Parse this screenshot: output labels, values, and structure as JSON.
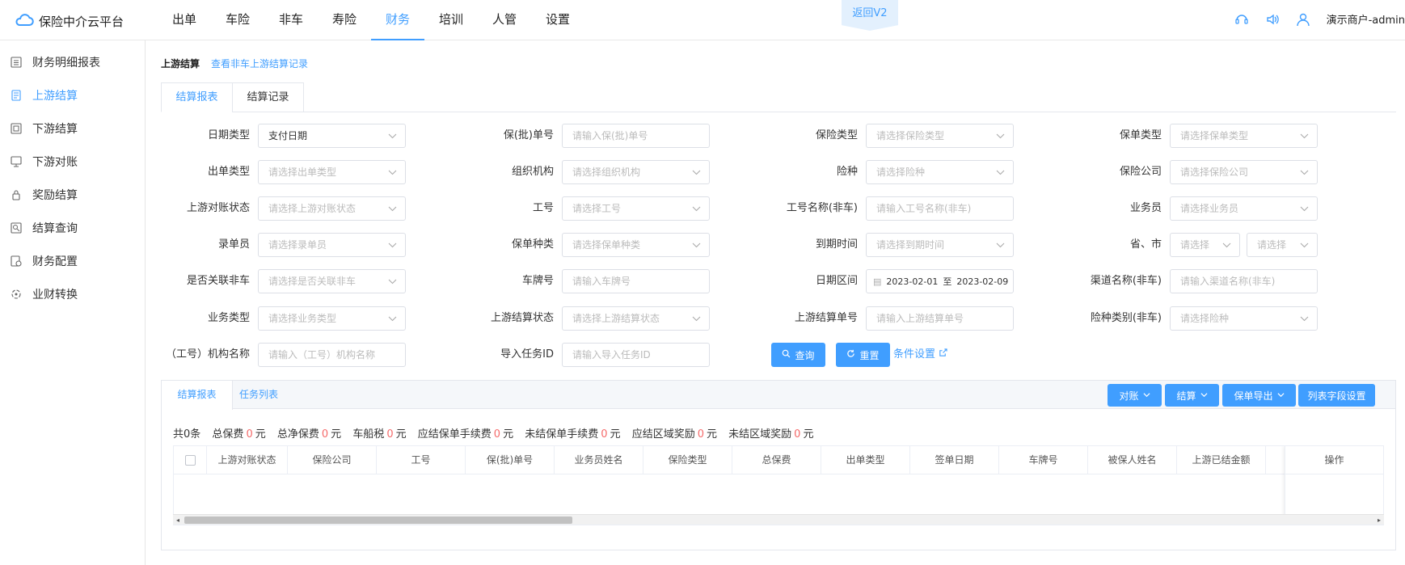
{
  "app": {
    "title": "保险中介云平台"
  },
  "topnav": [
    {
      "label": "出单",
      "active": false
    },
    {
      "label": "车险",
      "active": false
    },
    {
      "label": "非车",
      "active": false
    },
    {
      "label": "寿险",
      "active": false
    },
    {
      "label": "财务",
      "active": true
    },
    {
      "label": "培训",
      "active": false
    },
    {
      "label": "人管",
      "active": false
    },
    {
      "label": "设置",
      "active": false
    }
  ],
  "back_v2": "返回V2",
  "user": {
    "name": "演示商户-admin"
  },
  "sidebar": [
    {
      "label": "财务明细报表",
      "icon": "report-icon",
      "active": false
    },
    {
      "label": "上游结算",
      "icon": "upstream-settle-icon",
      "active": true
    },
    {
      "label": "下游结算",
      "icon": "downstream-settle-icon",
      "active": false
    },
    {
      "label": "下游对账",
      "icon": "reconcile-icon",
      "active": false
    },
    {
      "label": "奖励结算",
      "icon": "reward-icon",
      "active": false
    },
    {
      "label": "结算查询",
      "icon": "query-icon",
      "active": false
    },
    {
      "label": "财务配置",
      "icon": "config-icon",
      "active": false
    },
    {
      "label": "业财转换",
      "icon": "convert-icon",
      "active": false
    }
  ],
  "breadcrumb": {
    "title": "上游结算",
    "link": "查看非车上游结算记录"
  },
  "tabs": {
    "t1": "结算报表",
    "t2": "结算记录"
  },
  "filters": {
    "r1": [
      {
        "label": "日期类型",
        "value": "支付日期",
        "placeholder": "",
        "select": true
      },
      {
        "label": "保(批)单号",
        "value": "",
        "placeholder": "请输入保(批)单号",
        "select": false
      },
      {
        "label": "保险类型",
        "value": "",
        "placeholder": "请选择保险类型",
        "select": true
      },
      {
        "label": "保单类型",
        "value": "",
        "placeholder": "请选择保单类型",
        "select": true
      }
    ],
    "r2": [
      {
        "label": "出单类型",
        "value": "",
        "placeholder": "请选择出单类型",
        "select": true
      },
      {
        "label": "组织机构",
        "value": "",
        "placeholder": "请选择组织机构",
        "select": true
      },
      {
        "label": "险种",
        "value": "",
        "placeholder": "请选择险种",
        "select": true
      },
      {
        "label": "保险公司",
        "value": "",
        "placeholder": "请选择保险公司",
        "select": true
      }
    ],
    "r3": [
      {
        "label": "上游对账状态",
        "value": "",
        "placeholder": "请选择上游对账状态",
        "select": true
      },
      {
        "label": "工号",
        "value": "",
        "placeholder": "请选择工号",
        "select": true
      },
      {
        "label": "工号名称(非车)",
        "value": "",
        "placeholder": "请输入工号名称(非车)",
        "select": false
      },
      {
        "label": "业务员",
        "value": "",
        "placeholder": "请选择业务员",
        "select": true
      }
    ],
    "r4": [
      {
        "label": "录单员",
        "value": "",
        "placeholder": "请选择录单员",
        "select": true
      },
      {
        "label": "保单种类",
        "value": "",
        "placeholder": "请选择保单种类",
        "select": true
      },
      {
        "label": "到期时间",
        "value": "",
        "placeholder": "请选择到期时间",
        "select": true
      }
    ],
    "province_city": {
      "label": "省、市",
      "p1": "请选择",
      "p2": "请选择"
    },
    "r5": [
      {
        "label": "是否关联非车",
        "value": "",
        "placeholder": "请选择是否关联非车",
        "select": true
      },
      {
        "label": "车牌号",
        "value": "",
        "placeholder": "请输入车牌号",
        "select": false
      }
    ],
    "date_range": {
      "label": "日期区间",
      "start": "2023-02-01",
      "sep": "至",
      "end": "2023-02-09"
    },
    "r5b": {
      "label": "渠道名称(非车)",
      "placeholder": "请输入渠道名称(非车)"
    },
    "r6": [
      {
        "label": "业务类型",
        "value": "",
        "placeholder": "请选择业务类型",
        "select": true
      },
      {
        "label": "上游结算状态",
        "value": "",
        "placeholder": "请选择上游结算状态",
        "select": true
      },
      {
        "label": "上游结算单号",
        "value": "",
        "placeholder": "请输入上游结算单号",
        "select": false
      },
      {
        "label": "险种类别(非车)",
        "value": "",
        "placeholder": "请选择险种",
        "select": true
      }
    ],
    "r7": [
      {
        "label": "（工号）机构名称",
        "value": "",
        "placeholder": "请输入（工号）机构名称",
        "select": false
      },
      {
        "label": "导入任务ID",
        "value": "",
        "placeholder": "请输入导入任务ID",
        "select": false
      }
    ],
    "buttons": {
      "query": "查询",
      "reset": "重置",
      "condition": "条件设置"
    }
  },
  "panel": {
    "tab1": "结算报表",
    "tab2": "任务列表",
    "buttons": {
      "reconcile": "对账",
      "settle": "结算",
      "export": "保单导出",
      "columns": "列表字段设置"
    },
    "summary": [
      {
        "label": "共0条",
        "value": null,
        "unit": ""
      },
      {
        "label": "总保费",
        "value": "0",
        "unit": "元"
      },
      {
        "label": "总净保费",
        "value": "0",
        "unit": "元"
      },
      {
        "label": "车船税",
        "value": "0",
        "unit": "元"
      },
      {
        "label": "应结保单手续费",
        "value": "0",
        "unit": "元"
      },
      {
        "label": "未结保单手续费",
        "value": "0",
        "unit": "元"
      },
      {
        "label": "应结区域奖励",
        "value": "0",
        "unit": "元"
      },
      {
        "label": "未结区域奖励",
        "value": "0",
        "unit": "元"
      }
    ],
    "columns": [
      "上游对账状态",
      "保险公司",
      "工号",
      "保(批)单号",
      "业务员姓名",
      "保险类型",
      "总保费",
      "出单类型",
      "签单日期",
      "车牌号",
      "被保人姓名",
      "上游已结金额"
    ],
    "op_column": "操作"
  },
  "colors": {
    "primary": "#409eff",
    "danger": "#f56c6c"
  }
}
